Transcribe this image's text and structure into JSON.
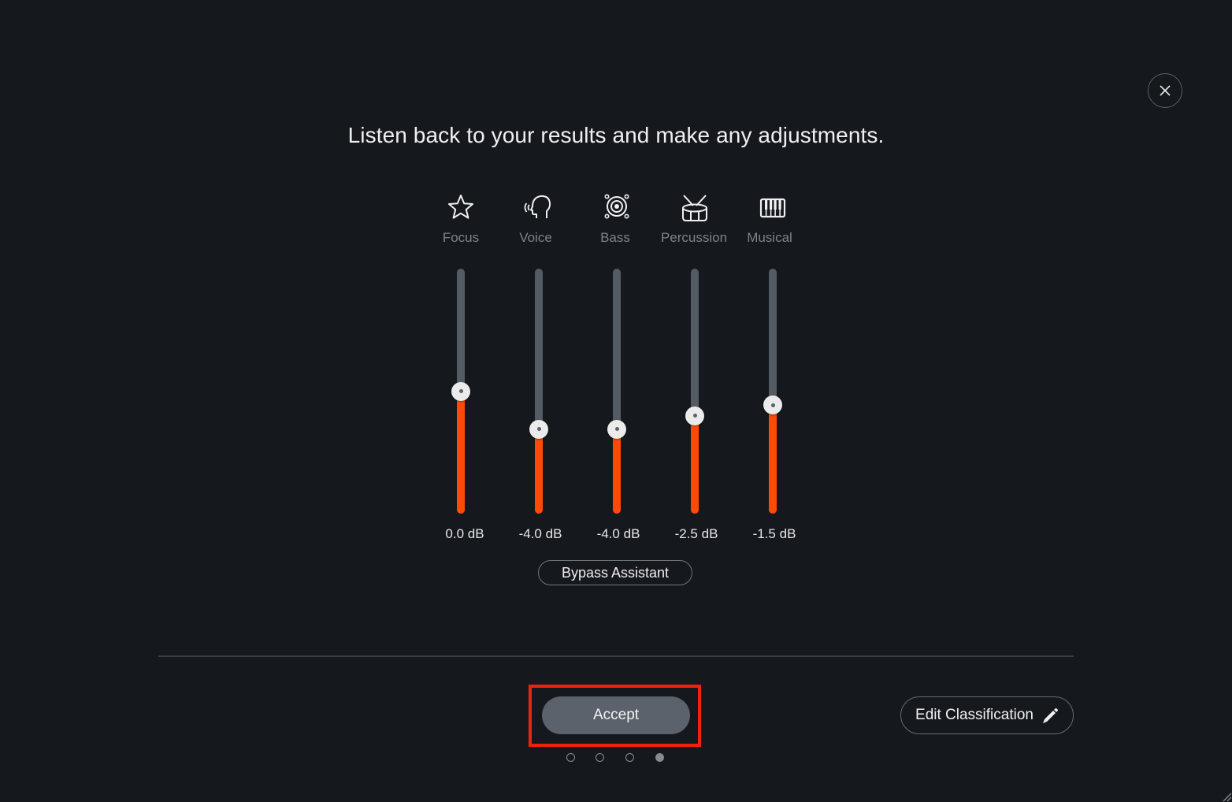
{
  "dialog": {
    "title": "Listen back to your results and make any adjustments.",
    "close_icon": "close-icon"
  },
  "channels": [
    {
      "name": "Focus",
      "icon": "star-icon",
      "value_label": "0.0 dB",
      "level_fraction": 0.5
    },
    {
      "name": "Voice",
      "icon": "voice-head-icon",
      "value_label": "-4.0 dB",
      "level_fraction": 0.345
    },
    {
      "name": "Bass",
      "icon": "speaker-icon",
      "value_label": "-4.0 dB",
      "level_fraction": 0.345
    },
    {
      "name": "Percussion",
      "icon": "drum-icon",
      "value_label": "-2.5 dB",
      "level_fraction": 0.4
    },
    {
      "name": "Musical",
      "icon": "piano-keys-icon",
      "value_label": "-1.5 dB",
      "level_fraction": 0.443
    }
  ],
  "buttons": {
    "bypass": "Bypass Assistant",
    "accept": "Accept",
    "edit_classification": "Edit Classification"
  },
  "pagination": {
    "total": 4,
    "current": 4
  },
  "colors": {
    "accent": "#ff4a05",
    "track": "#545b63",
    "highlight": "#f0210f",
    "background": "#15181d"
  }
}
